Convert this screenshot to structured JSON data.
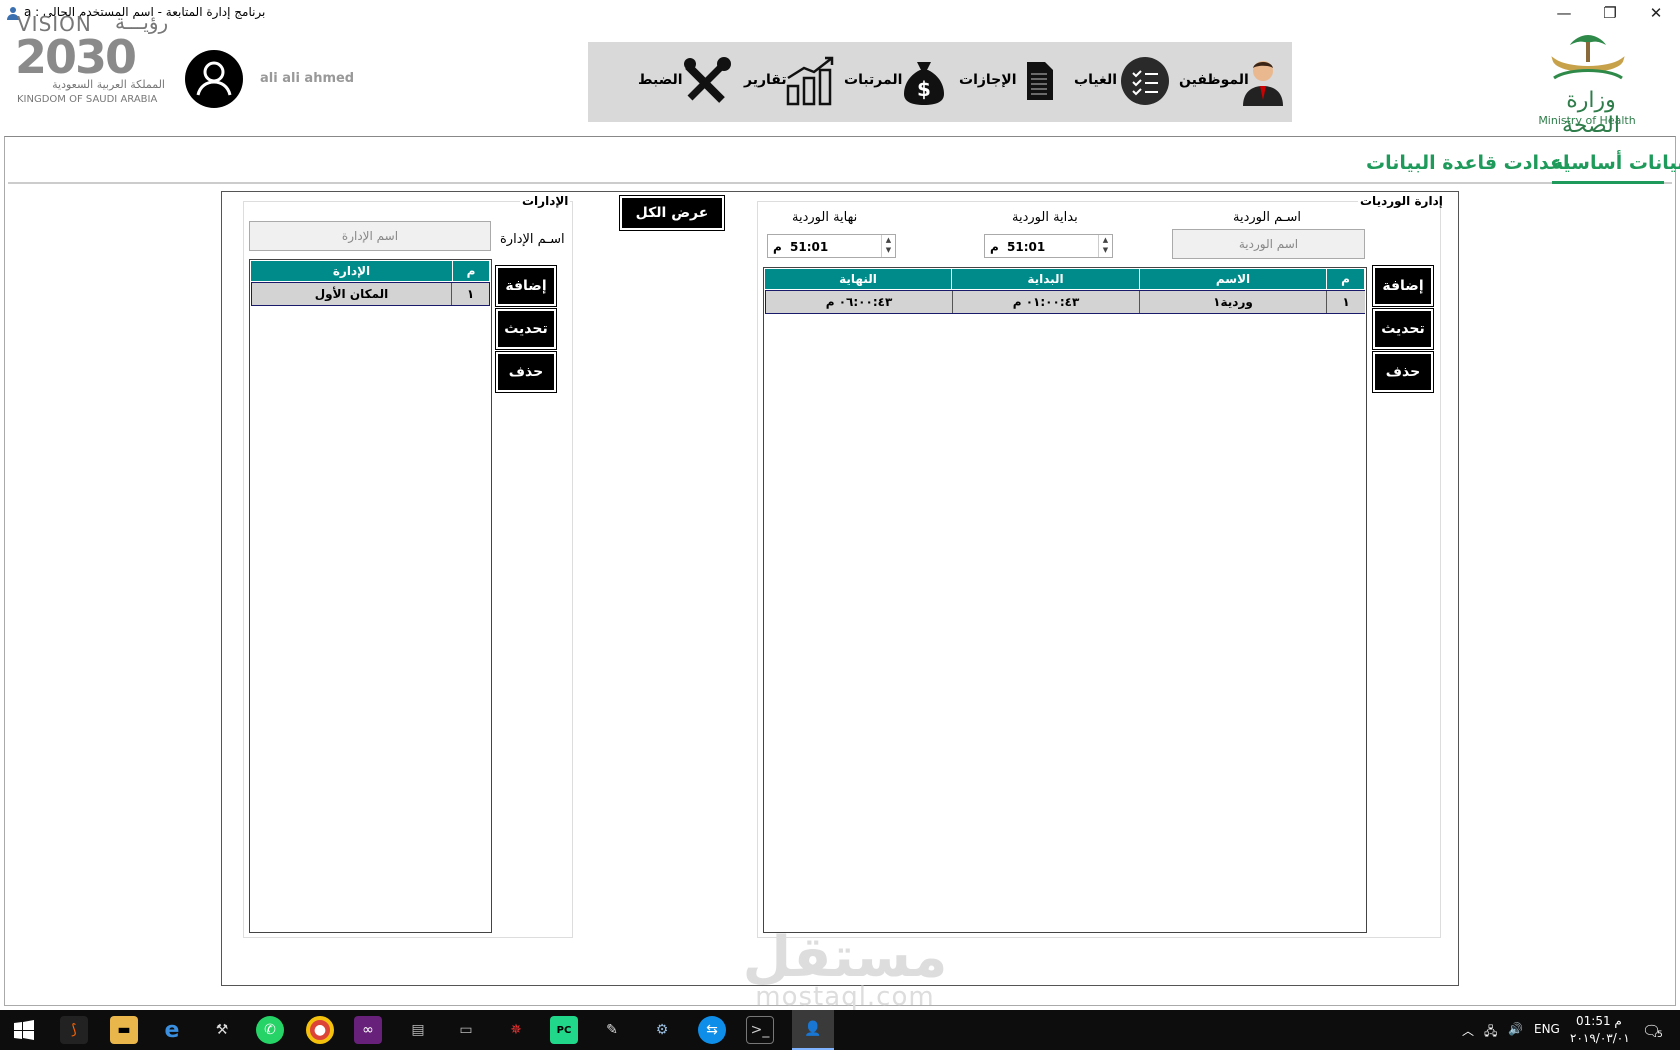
{
  "window": {
    "title": "برنامج إدارة المتابعة  -  اسم المستخدم الحالى  :  a",
    "min": "—",
    "restore": "❐",
    "close": "✕"
  },
  "header": {
    "vision": {
      "top": "VISION",
      "top_ar": "رؤيـــة",
      "year": "2030",
      "ar": "المملكة العربية السعودية",
      "en": "KINGDOM OF SAUDI ARABIA"
    },
    "username": "ali ali ahmed",
    "moh": {
      "ar": "وزارة الصحة",
      "en": "Ministry of Health"
    },
    "nav": [
      {
        "label": "الموظفين",
        "icon": "employee-icon"
      },
      {
        "label": "الغياب",
        "icon": "checklist-icon"
      },
      {
        "label": "الإجازات",
        "icon": "document-icon"
      },
      {
        "label": "المرتبات",
        "icon": "money-bag-icon"
      },
      {
        "label": "تقارير",
        "icon": "chart-icon"
      },
      {
        "label": "الضبط",
        "icon": "tools-icon"
      }
    ]
  },
  "tabs": [
    {
      "label": "بيانات أساسية",
      "active": true
    },
    {
      "label": "اعدادت قاعدة البيانات",
      "active": false
    }
  ],
  "show_all_button": "عرض الكل",
  "shifts": {
    "group_label": "إدارة الورديات",
    "name_label": "اسـم الوردية",
    "name_placeholder": "اسم الوردية",
    "start_label": "بداية الوردية",
    "end_label": "نهاية الوردية",
    "start_value": "51:01",
    "end_value": "51:01",
    "ampm": "م",
    "buttons": {
      "add": "إضافة",
      "update": "تحديث",
      "delete": "حذف"
    },
    "columns": [
      "م",
      "الاسم",
      "البداية",
      "النهاية"
    ],
    "rows": [
      {
        "num": "١",
        "name": "وردية١",
        "start": "٠١:٠٠:٤٣ م",
        "end": "٠٦:٠٠:٤٣ م"
      }
    ]
  },
  "departments": {
    "group_label": "الإدارات",
    "name_label": "اسـم الإدارة",
    "name_placeholder": "اسم الإدارة",
    "buttons": {
      "add": "إضافة",
      "update": "تحديث",
      "delete": "حذف"
    },
    "columns": [
      "م",
      "الإدارة"
    ],
    "rows": [
      {
        "num": "١",
        "name": "المكان الأول"
      }
    ]
  },
  "watermark": {
    "ar": "مستقل",
    "en": "mostaql.com"
  },
  "taskbar": {
    "lang": "ENG",
    "time": "01:51 م",
    "date": "٢٠١٩/٠٣/٠١",
    "notif_count": "5"
  }
}
